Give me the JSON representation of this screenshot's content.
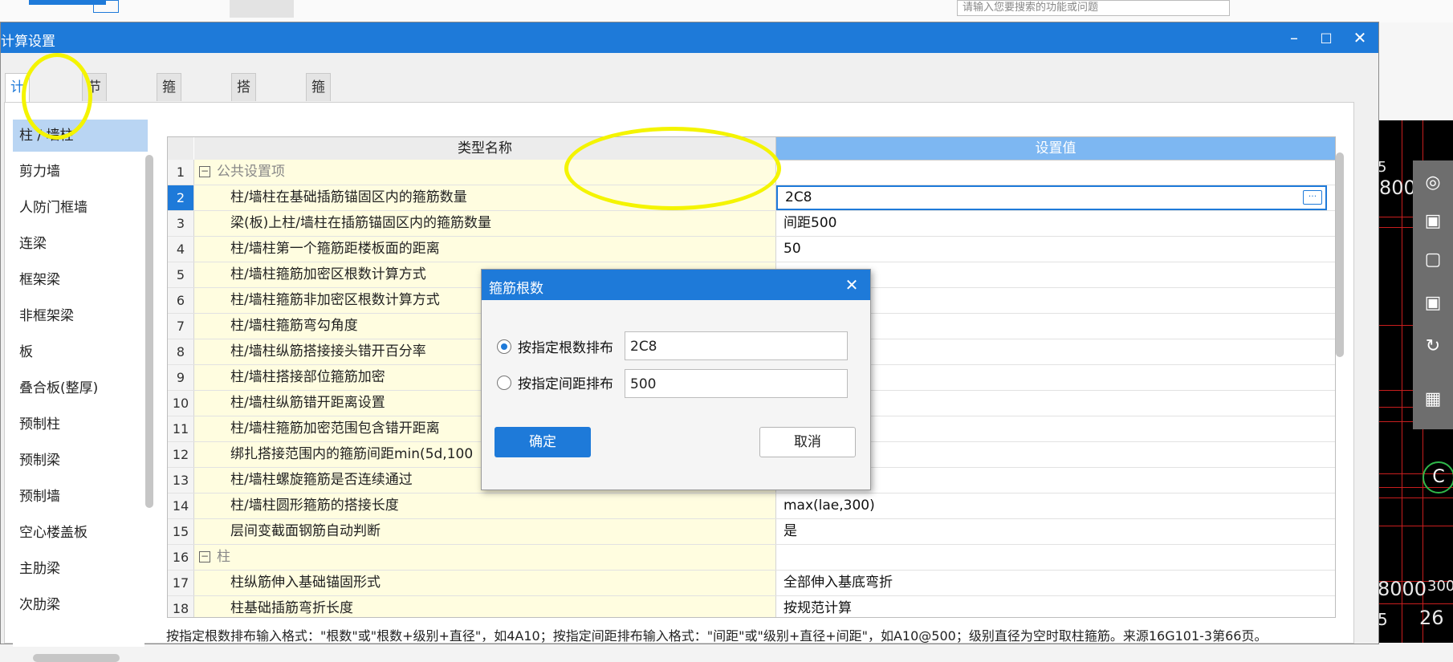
{
  "app": {
    "search_placeholder": "请输入您要搜索的功能或问题"
  },
  "cad": {
    "labels": [
      "5",
      "800",
      "C",
      "8000",
      "300",
      "5",
      "26"
    ]
  },
  "dialog": {
    "title": "计算设置",
    "tabs": [
      "计算规则",
      "节点设置",
      "箍筋设置",
      "搭接设置",
      "箍筋公式"
    ],
    "categories": [
      "柱 / 墙柱",
      "剪力墙",
      "人防门框墙",
      "连梁",
      "框架梁",
      "非框架梁",
      "板",
      "叠合板(整厚)",
      "预制柱",
      "预制梁",
      "预制墙",
      "空心楼盖板",
      "主肋梁",
      "次肋梁"
    ],
    "grid": {
      "col_name": "类型名称",
      "col_value": "设置值",
      "rows": [
        {
          "n": "1",
          "name": "公共设置项",
          "value": "",
          "group": true
        },
        {
          "n": "2",
          "name": "柱/墙柱在基础插筋锚固区内的箍筋数量",
          "value": "2C8"
        },
        {
          "n": "3",
          "name": "梁(板)上柱/墙柱在插筋锚固区内的箍筋数量",
          "value": "间距500"
        },
        {
          "n": "4",
          "name": "柱/墙柱第一个箍筋距楼板面的距离",
          "value": "50"
        },
        {
          "n": "5",
          "name": "柱/墙柱箍筋加密区根数计算方式",
          "value": ""
        },
        {
          "n": "6",
          "name": "柱/墙柱箍筋非加密区根数计算方式",
          "value": ""
        },
        {
          "n": "7",
          "name": "柱/墙柱箍筋弯勾角度",
          "value": ""
        },
        {
          "n": "8",
          "name": "柱/墙柱纵筋搭接接头错开百分率",
          "value": ""
        },
        {
          "n": "9",
          "name": "柱/墙柱搭接部位箍筋加密",
          "value": ""
        },
        {
          "n": "10",
          "name": "柱/墙柱纵筋错开距离设置",
          "value": ""
        },
        {
          "n": "11",
          "name": "柱/墙柱箍筋加密范围包含错开距离",
          "value": ""
        },
        {
          "n": "12",
          "name": "绑扎搭接范围内的箍筋间距min(5d,100",
          "value": ""
        },
        {
          "n": "13",
          "name": "柱/墙柱螺旋箍筋是否连续通过",
          "value": ""
        },
        {
          "n": "14",
          "name": "柱/墙柱圆形箍筋的搭接长度",
          "value": "max(lae,300)"
        },
        {
          "n": "15",
          "name": "层间变截面钢筋自动判断",
          "value": "是"
        },
        {
          "n": "16",
          "name": "柱",
          "value": "",
          "group": true
        },
        {
          "n": "17",
          "name": "柱纵筋伸入基础锚固形式",
          "value": "全部伸入基底弯折"
        },
        {
          "n": "18",
          "name": "柱基础插筋弯折长度",
          "value": "按规范计算"
        }
      ]
    },
    "hint": "按指定根数排布输入格式：\"根数\"或\"根数+级别+直径\"，如4A10；按指定间距排布输入格式：\"间距\"或\"级别+直径+间距\"，如A10@500；级别直径为空时取柱箍筋。来源16G101-3第66页。"
  },
  "popup": {
    "title": "箍筋根数",
    "option1_label": "按指定根数排布",
    "option1_value": "2C8",
    "option2_label": "按指定间距排布",
    "option2_value": "500",
    "ok_label": "确定",
    "cancel_label": "取消"
  }
}
